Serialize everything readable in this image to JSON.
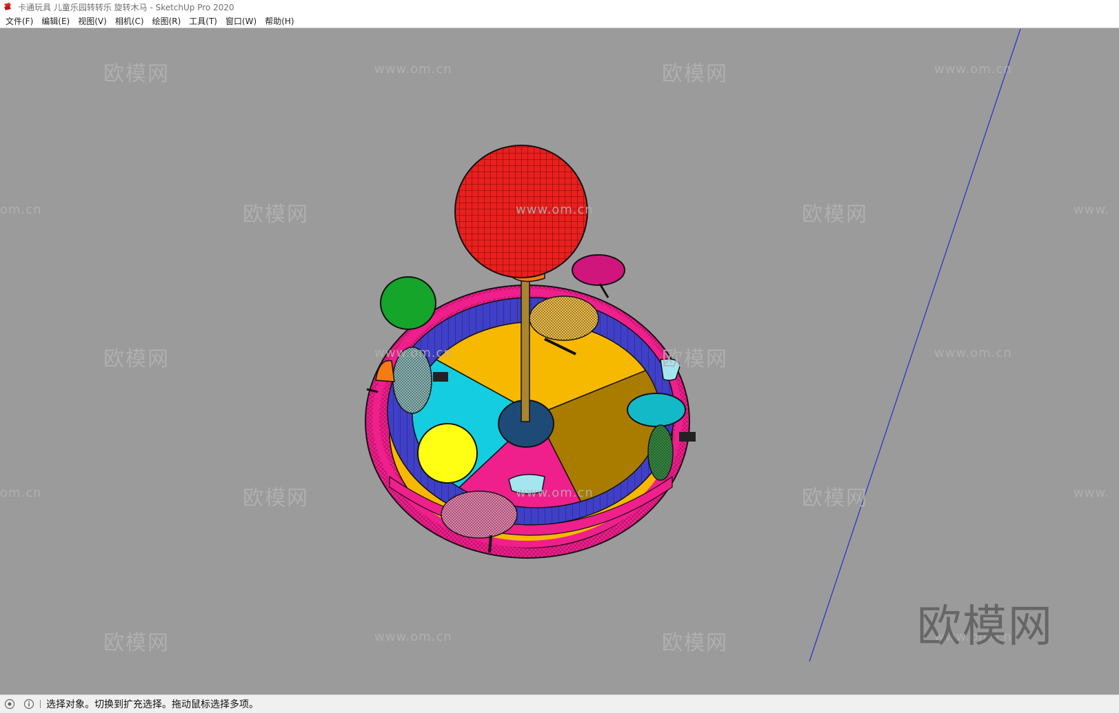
{
  "window": {
    "title": "卡通玩具 儿童乐园转转乐 旋转木马 - SketchUp Pro 2020"
  },
  "menu": [
    {
      "label": "文件(F)"
    },
    {
      "label": "编辑(E)"
    },
    {
      "label": "视图(V)"
    },
    {
      "label": "相机(C)"
    },
    {
      "label": "绘图(R)"
    },
    {
      "label": "工具(T)"
    },
    {
      "label": "窗口(W)"
    },
    {
      "label": "帮助(H)"
    }
  ],
  "watermarks": {
    "brand": "欧模网",
    "url": "www.om.cn",
    "url_partial_left": "om.cn",
    "url_partial_right": "www."
  },
  "colors": {
    "viewport_bg": "#9b9b9b",
    "ball": "#e8201e",
    "base_ring": "#ef1f8c",
    "wall": "#3f3fc8",
    "floor_yellow": "#f7b800",
    "floor_cyan": "#14cde0",
    "floor_pink": "#ef1f8c",
    "floor_olive": "#a97c00",
    "axis_line": "#2a2ad0"
  },
  "icons": {
    "app": "sketchup-logo-icon",
    "status_left": "question-icon",
    "status_mid": "info-icon"
  },
  "status": {
    "text": "选择对象。切换到扩充选择。拖动鼠标选择多项。"
  }
}
